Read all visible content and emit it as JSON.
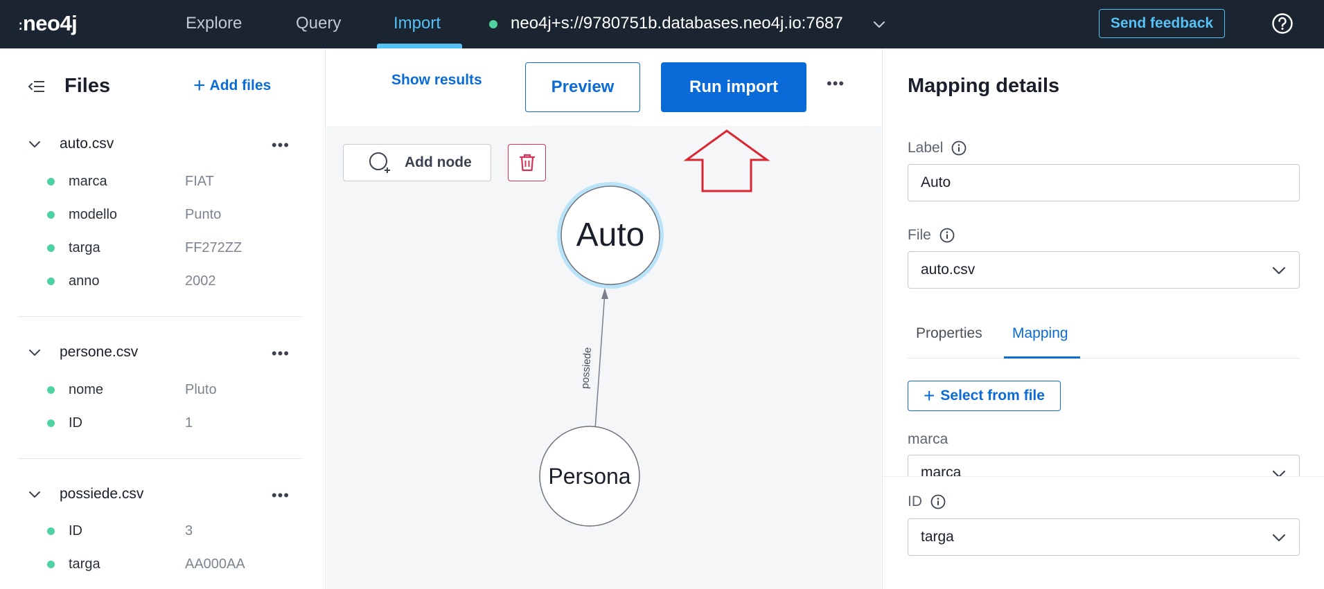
{
  "topbar": {
    "logo": "neo4j",
    "tabs": [
      {
        "label": "Explore",
        "active": false
      },
      {
        "label": "Query",
        "active": false
      },
      {
        "label": "Import",
        "active": true
      }
    ],
    "connection": {
      "status_color": "#4dd2a0",
      "uri": "neo4j+s://9780751b.databases.neo4j.io:7687"
    },
    "feedback_label": "Send feedback"
  },
  "files_panel": {
    "title": "Files",
    "add_files_label": "Add files",
    "files": [
      {
        "name": "auto.csv",
        "columns": [
          {
            "name": "marca",
            "value": "FIAT"
          },
          {
            "name": "modello",
            "value": "Punto"
          },
          {
            "name": "targa",
            "value": "FF272ZZ"
          },
          {
            "name": "anno",
            "value": "2002"
          }
        ]
      },
      {
        "name": "persone.csv",
        "columns": [
          {
            "name": "nome",
            "value": "Pluto"
          },
          {
            "name": "ID",
            "value": "1"
          }
        ]
      },
      {
        "name": "possiede.csv",
        "columns": [
          {
            "name": "ID",
            "value": "3"
          },
          {
            "name": "targa",
            "value": "AA000AA"
          }
        ]
      }
    ]
  },
  "toolbar": {
    "show_results_label": "Show results",
    "preview_label": "Preview",
    "run_import_label": "Run import",
    "add_node_label": "Add node"
  },
  "graph": {
    "nodes": [
      {
        "label": "Auto",
        "selected": true
      },
      {
        "label": "Persona",
        "selected": false
      }
    ],
    "relationship": {
      "label": "possiede",
      "from": "Persona",
      "to": "Auto"
    },
    "annotation_color": "#d9262f"
  },
  "mapping": {
    "title": "Mapping details",
    "label_field": {
      "label": "Label",
      "value": "Auto"
    },
    "file_field": {
      "label": "File",
      "value": "auto.csv"
    },
    "tabs": [
      {
        "label": "Properties",
        "active": false
      },
      {
        "label": "Mapping",
        "active": true
      }
    ],
    "select_from_file_label": "Select from file",
    "property_label": "marca",
    "property_value": "marca",
    "id_field": {
      "label": "ID",
      "value": "targa"
    }
  }
}
